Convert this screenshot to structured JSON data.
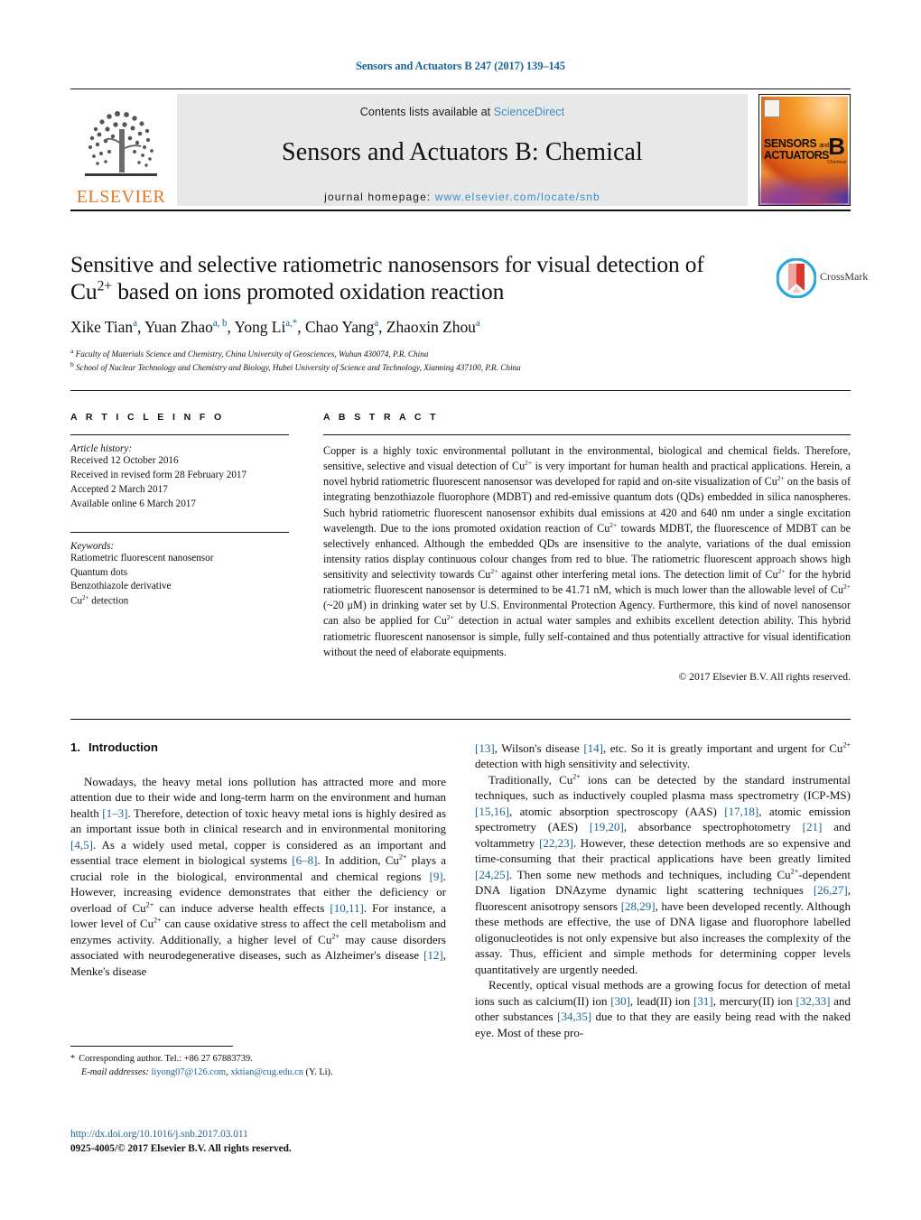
{
  "running_head": "Sensors and Actuators B 247 (2017) 139–145",
  "banner": {
    "publisher_name": "ELSEVIER",
    "contents_prefix": "Contents lists available at ",
    "contents_link": "ScienceDirect",
    "journal_title": "Sensors and Actuators B: Chemical",
    "homepage_prefix": "journal homepage: ",
    "homepage_url": "www.elsevier.com/locate/snb",
    "cover": {
      "line1": "SENSORS",
      "and": "and",
      "line2": "ACTUATORS",
      "letter": "B",
      "subtitle": "Chemical"
    }
  },
  "title": {
    "line1": "Sensitive and selective ratiometric nanosensors for visual detection of",
    "line2_pre": "Cu",
    "line2_sup": "2+",
    "line2_post": " based on ions promoted oxidation reaction"
  },
  "crossmark": {
    "label": "CrossMark"
  },
  "authors": [
    {
      "name": "Xike Tian",
      "sup": "a",
      "sep": ", "
    },
    {
      "name": "Yuan Zhao",
      "sup": "a, b",
      "sep": ", "
    },
    {
      "name": "Yong Li",
      "sup": "a,*",
      "sep": ", "
    },
    {
      "name": "Chao Yang",
      "sup": "a",
      "sep": ", "
    },
    {
      "name": "Zhaoxin Zhou",
      "sup": "a",
      "sep": ""
    }
  ],
  "affiliations": [
    {
      "marker": "a",
      "text": "Faculty of Materials Science and Chemistry, China University of Geosciences, Wuhan 430074, P.R. China"
    },
    {
      "marker": "b",
      "text": "School of Nuclear Technology and Chemistry and Biology, Hubei University of Science and Technology, Xianning 437100, P.R. China"
    }
  ],
  "article_info": {
    "heading": "A R T I C L E   I N F O",
    "history_heading": "Article history:",
    "history": [
      "Received 12 October 2016",
      "Received in revised form 28 February 2017",
      "Accepted 2 March 2017",
      "Available online 6 March 2017"
    ],
    "keywords_heading": "Keywords:",
    "keywords": [
      "Ratiometric fluorescent nanosensor",
      "Quantum dots",
      "Benzothiazole derivative",
      "Cu2+ detection"
    ],
    "keyword_cu": {
      "pre": "Cu",
      "sup": "2+",
      "post": " detection"
    }
  },
  "abstract": {
    "heading": "A B S T R A C T",
    "text": "Copper is a highly toxic environmental pollutant in the environmental, biological and chemical fields. Therefore, sensitive, selective and visual detection of Cu2+ is very important for human health and practical applications. Herein, a novel hybrid ratiometric fluorescent nanosensor was developed for rapid and on-site visualization of Cu2+ on the basis of integrating benzothiazole fluorophore (MDBT) and red-emissive quantum dots (QDs) embedded in silica nanospheres. Such hybrid ratiometric fluorescent nanosensor exhibits dual emissions at 420 and 640 nm under a single excitation wavelength. Due to the ions promoted oxidation reaction of Cu2+ towards MDBT, the fluorescence of MDBT can be selectively enhanced. Although the embedded QDs are insensitive to the analyte, variations of the dual emission intensity ratios display continuous colour changes from red to blue. The ratiometric fluorescent approach shows high sensitivity and selectivity towards Cu2+ against other interfering metal ions. The detection limit of Cu2+ for the hybrid ratiometric fluorescent nanosensor is determined to be 41.71 nM, which is much lower than the allowable level of Cu2+ (~20 μM) in drinking water set by U.S. Environmental Protection Agency. Furthermore, this kind of novel nanosensor can also be applied for Cu2+ detection in actual water samples and exhibits excellent detection ability. This hybrid ratiometric fluorescent nanosensor is simple, fully self-contained and thus potentially attractive for visual identification without the need of elaborate equipments.",
    "copyright": "© 2017 Elsevier B.V. All rights reserved."
  },
  "section_intro": {
    "number": "1.",
    "title": "Introduction",
    "paragraph1": "Nowadays, the heavy metal ions pollution has attracted more and more attention due to their wide and long-term harm on the environment and human health [1–3]. Therefore, detection of toxic heavy metal ions is highly desired as an important issue both in clinical research and in environmental monitoring [4,5]. As a widely used metal, copper is considered as an important and essential trace element in biological systems [6–8]. In addition, Cu2+ plays a crucial role in the biological, environmental and chemical regions [9]. However, increasing evidence demonstrates that either the deficiency or overload of Cu2+ can induce adverse health effects [10,11]. For instance, a lower level of Cu2+ can cause oxidative stress to affect the cell metabolism and enzymes activity. Additionally, a higher level of Cu2+ may cause disorders associated with neurodegenerative diseases, such as Alzheimer's disease [12], Menke's disease [13], Wilson's disease [14], etc. So it is greatly important and urgent for Cu2+ detection with high sensitivity and selectivity.",
    "paragraph2": "Traditionally, Cu2+ ions can be detected by the standard instrumental techniques, such as inductively coupled plasma mass spectrometry (ICP-MS) [15,16], atomic absorption spectroscopy (AAS) [17,18], atomic emission spectrometry (AES) [19,20], absorbance spectrophotometry [21] and voltammetry [22,23]. However, these detection methods are so expensive and time-consuming that their practical applications have been greatly limited [24,25]. Then some new methods and techniques, including Cu2+-dependent DNA ligation DNAzyme dynamic light scattering techniques [26,27], fluorescent anisotropy sensors [28,29], have been developed recently. Although these methods are effective, the use of DNA ligase and fluorophore labelled oligonucleotides is not only expensive but also increases the complexity of the assay. Thus, efficient and simple methods for determining copper levels quantitatively are urgently needed.",
    "paragraph3": "Recently, optical visual methods are a growing focus for detection of metal ions such as calcium(II) ion [30], lead(II) ion [31], mercury(II) ion [32,33] and other substances [34,35] due to that they are easily being read with the naked eye. Most of these pro-"
  },
  "footnote": {
    "star": "*",
    "corresponding": "Corresponding author. Tel.: +86 27 67883739.",
    "email_label": "E-mail addresses:",
    "email1": "liyong07@126.com",
    "email_sep": ", ",
    "email2": "xktian@cug.edu.cn",
    "email_suffix": " (Y. Li)."
  },
  "footer": {
    "doi": "http://dx.doi.org/10.1016/j.snb.2017.03.011",
    "issn": "0925-4005/© 2017 Elsevier B.V. All rights reserved."
  },
  "colors": {
    "link": "#1a6496",
    "elsevier_orange": "#E87722",
    "banner_bg": "#e8e8e8"
  }
}
